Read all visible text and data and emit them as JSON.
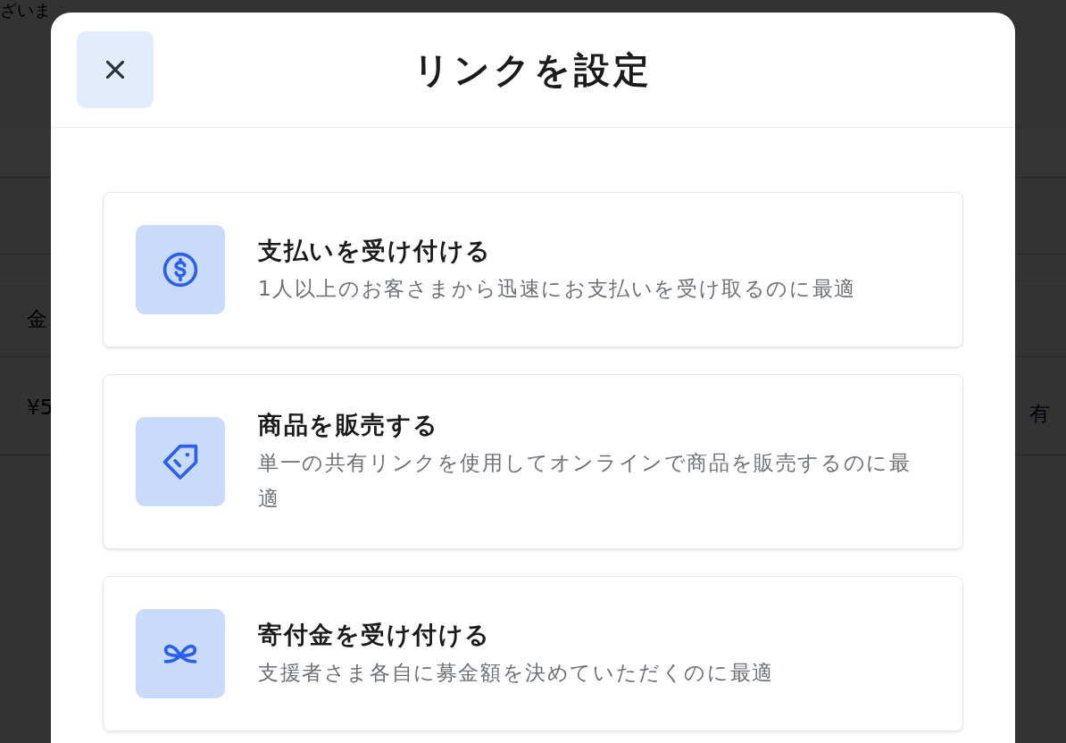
{
  "background_page": {
    "banner_text": "ざいま",
    "table_header": "金",
    "table_row": {
      "amount": "¥5",
      "link": "有"
    }
  },
  "dialog": {
    "title": "リンクを設定",
    "options": [
      {
        "kind": "payment",
        "title": "支払いを受け付ける",
        "description": "1人以上のお客さまから迅速にお支払いを受け取るのに最適"
      },
      {
        "kind": "product",
        "title": "商品を販売する",
        "description": "単一の共有リンクを使用してオンラインで商品を販売するのに最適"
      },
      {
        "kind": "donation",
        "title": "寄付金を受け付ける",
        "description": "支援者さま各自に募金額を決めていただくのに最適"
      }
    ]
  }
}
